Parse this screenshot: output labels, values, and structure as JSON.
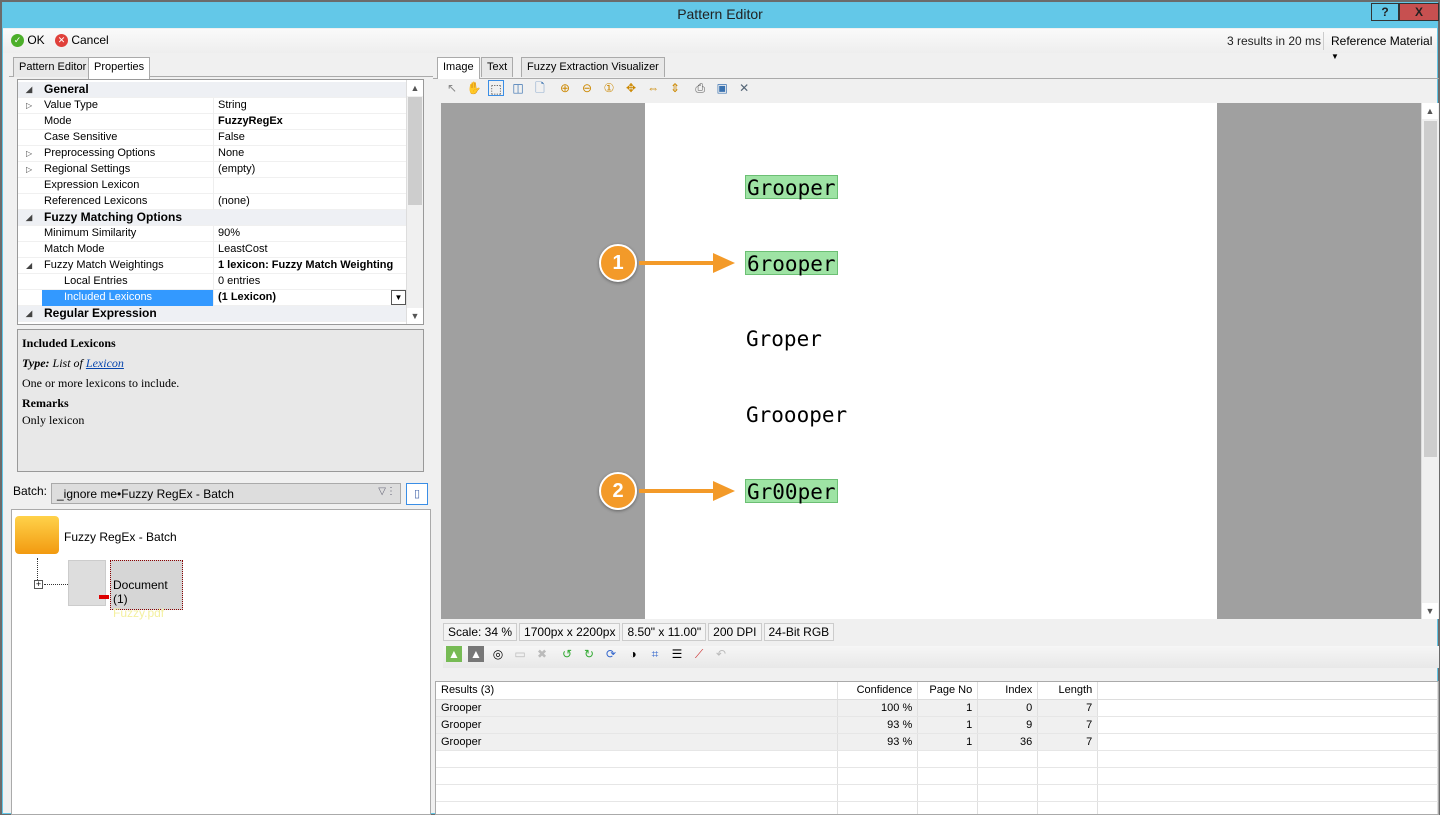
{
  "window": {
    "title": "Pattern Editor",
    "help": "?",
    "close": "X"
  },
  "toolbar": {
    "ok": "OK",
    "cancel": "Cancel",
    "status": "3 results in 20 ms",
    "reference": "Reference Material"
  },
  "left_tabs": [
    "Pattern Editor",
    "Properties"
  ],
  "properties": [
    {
      "type": "cat",
      "expander": "◢",
      "name": "General"
    },
    {
      "expander": "▷",
      "name": "Value Type",
      "value": "String"
    },
    {
      "name": "Mode",
      "value": "FuzzyRegEx",
      "bold": true
    },
    {
      "name": "Case Sensitive",
      "value": "False"
    },
    {
      "expander": "▷",
      "name": "Preprocessing Options",
      "value": "None"
    },
    {
      "expander": "▷",
      "name": "Regional Settings",
      "value": "(empty)"
    },
    {
      "name": "Expression Lexicon",
      "value": ""
    },
    {
      "name": "Referenced Lexicons",
      "value": "(none)"
    },
    {
      "type": "cat",
      "expander": "◢",
      "name": "Fuzzy Matching Options"
    },
    {
      "name": "Minimum Similarity",
      "value": "90%"
    },
    {
      "name": "Match Mode",
      "value": "LeastCost"
    },
    {
      "expander": "◢",
      "name": "Fuzzy Match Weightings",
      "value": "1 lexicon: Fuzzy Match Weighting",
      "bold": true
    },
    {
      "name": "Local Entries",
      "value": "0 entries",
      "indent": true
    },
    {
      "name": "Included Lexicons",
      "value": "(1 Lexicon)",
      "bold": true,
      "indent": true,
      "selected": true
    },
    {
      "type": "cat",
      "expander": "◢",
      "name": "Regular Expression"
    }
  ],
  "description": {
    "title": "Included Lexicons",
    "type_label": "Type:",
    "type_text": "List of",
    "type_link": "Lexicon",
    "text": "One or more lexicons to include.",
    "remarks_title": "Remarks",
    "remarks": "Only lexicon"
  },
  "batch": {
    "label": "Batch:",
    "value": "_ignore me•Fuzzy RegEx - Batch"
  },
  "tree": {
    "root": "Fuzzy RegEx - Batch",
    "document": "Document (1)",
    "file": "Fuzzy.pdf"
  },
  "right_tabs": [
    "Image",
    "Text",
    "Fuzzy Extraction Visualizer"
  ],
  "image": {
    "words": [
      {
        "text": "Grooper",
        "highlighted": true
      },
      {
        "text": "6rooper",
        "highlighted": true,
        "callout": "1"
      },
      {
        "text": "Groper",
        "highlighted": false
      },
      {
        "text": "Groooper",
        "highlighted": false
      },
      {
        "text": "Gr00per",
        "highlighted": true,
        "callout": "2"
      }
    ],
    "highlight_color": "#9ee3a4",
    "callout_color": "#f39a29"
  },
  "status": {
    "scale": "Scale: 34 %",
    "pixels": "1700px x 2200px",
    "inches": "8.50\" x 11.00\"",
    "dpi": "200 DPI",
    "color": "24-Bit RGB"
  },
  "results": {
    "headers": [
      "Results (3)",
      "Confidence",
      "Page No",
      "Index",
      "Length"
    ],
    "rows": [
      [
        "Grooper",
        "100 %",
        "1",
        "0",
        "7"
      ],
      [
        "Grooper",
        "93 %",
        "1",
        "9",
        "7"
      ],
      [
        "Grooper",
        "93 %",
        "1",
        "36",
        "7"
      ]
    ]
  }
}
